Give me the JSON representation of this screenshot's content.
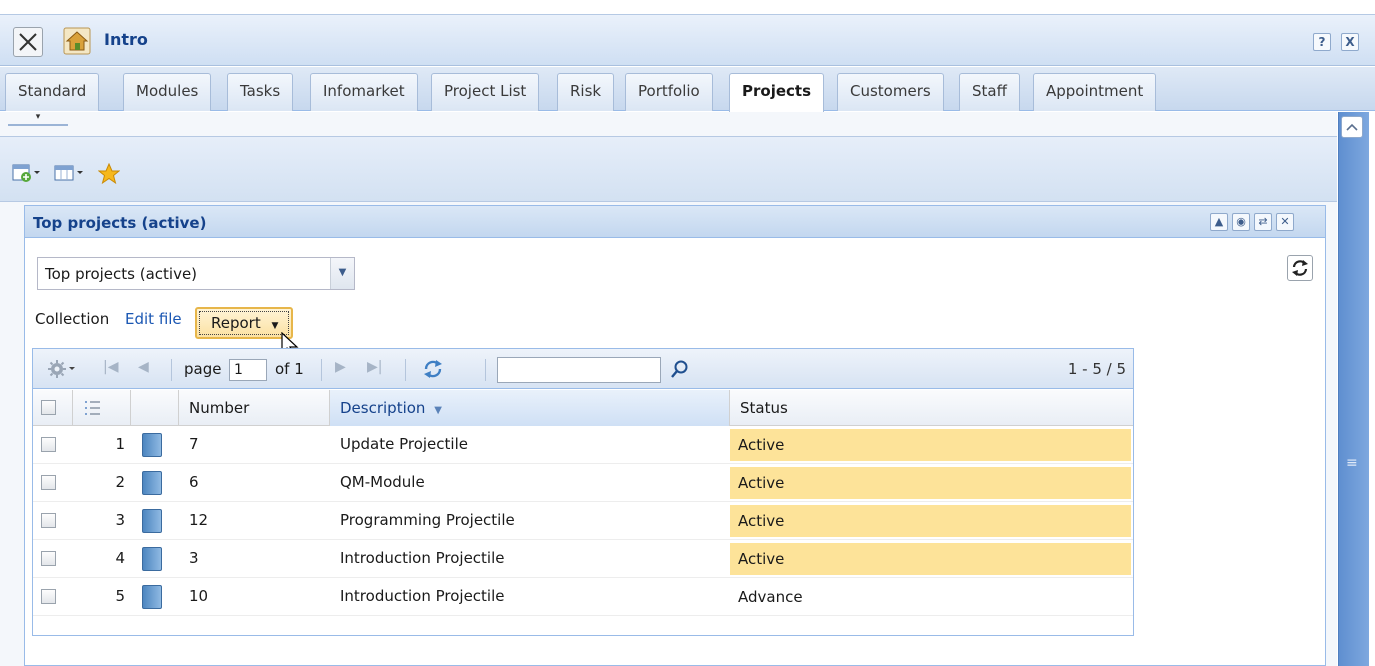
{
  "window": {
    "title": "Intro",
    "help_label": "?",
    "close_label": "X"
  },
  "tabs": [
    {
      "label": "Standard"
    },
    {
      "label": "Modules"
    },
    {
      "label": "Tasks"
    },
    {
      "label": "Infomarket"
    },
    {
      "label": "Project List"
    },
    {
      "label": "Risk"
    },
    {
      "label": "Portfolio"
    },
    {
      "label": "Projects",
      "active": true
    },
    {
      "label": "Customers"
    },
    {
      "label": "Staff"
    },
    {
      "label": "Appointment"
    }
  ],
  "toolbar": {
    "icons": [
      "new-view-icon",
      "layout-icon",
      "favorite-star-icon"
    ]
  },
  "panel": {
    "title": "Top projects (active)",
    "selector_value": "Top projects (active)",
    "collection_label": "Collection",
    "edit_file_label": "Edit file",
    "report_button_label": "Report"
  },
  "grid": {
    "page_label": "page",
    "page_value": "1",
    "of_label": "of 1",
    "search_value": "",
    "paging_info": "1 - 5 / 5",
    "columns": {
      "number": "Number",
      "description": "Description",
      "status": "Status"
    },
    "rows": [
      {
        "idx": "1",
        "number": "7",
        "description": "Update Projectile",
        "status": "Active"
      },
      {
        "idx": "2",
        "number": "6",
        "description": "QM-Module",
        "status": "Active"
      },
      {
        "idx": "3",
        "number": "12",
        "description": "Programming Projectile",
        "status": "Active"
      },
      {
        "idx": "4",
        "number": "3",
        "description": "Introduction Projectile",
        "status": "Active"
      },
      {
        "idx": "5",
        "number": "10",
        "description": "Introduction Projectile",
        "status": "Advance"
      }
    ]
  },
  "colors": {
    "active_status_bg": "#fde399",
    "header_blue": "#15428b",
    "scrollbar": "#6a98d6"
  }
}
